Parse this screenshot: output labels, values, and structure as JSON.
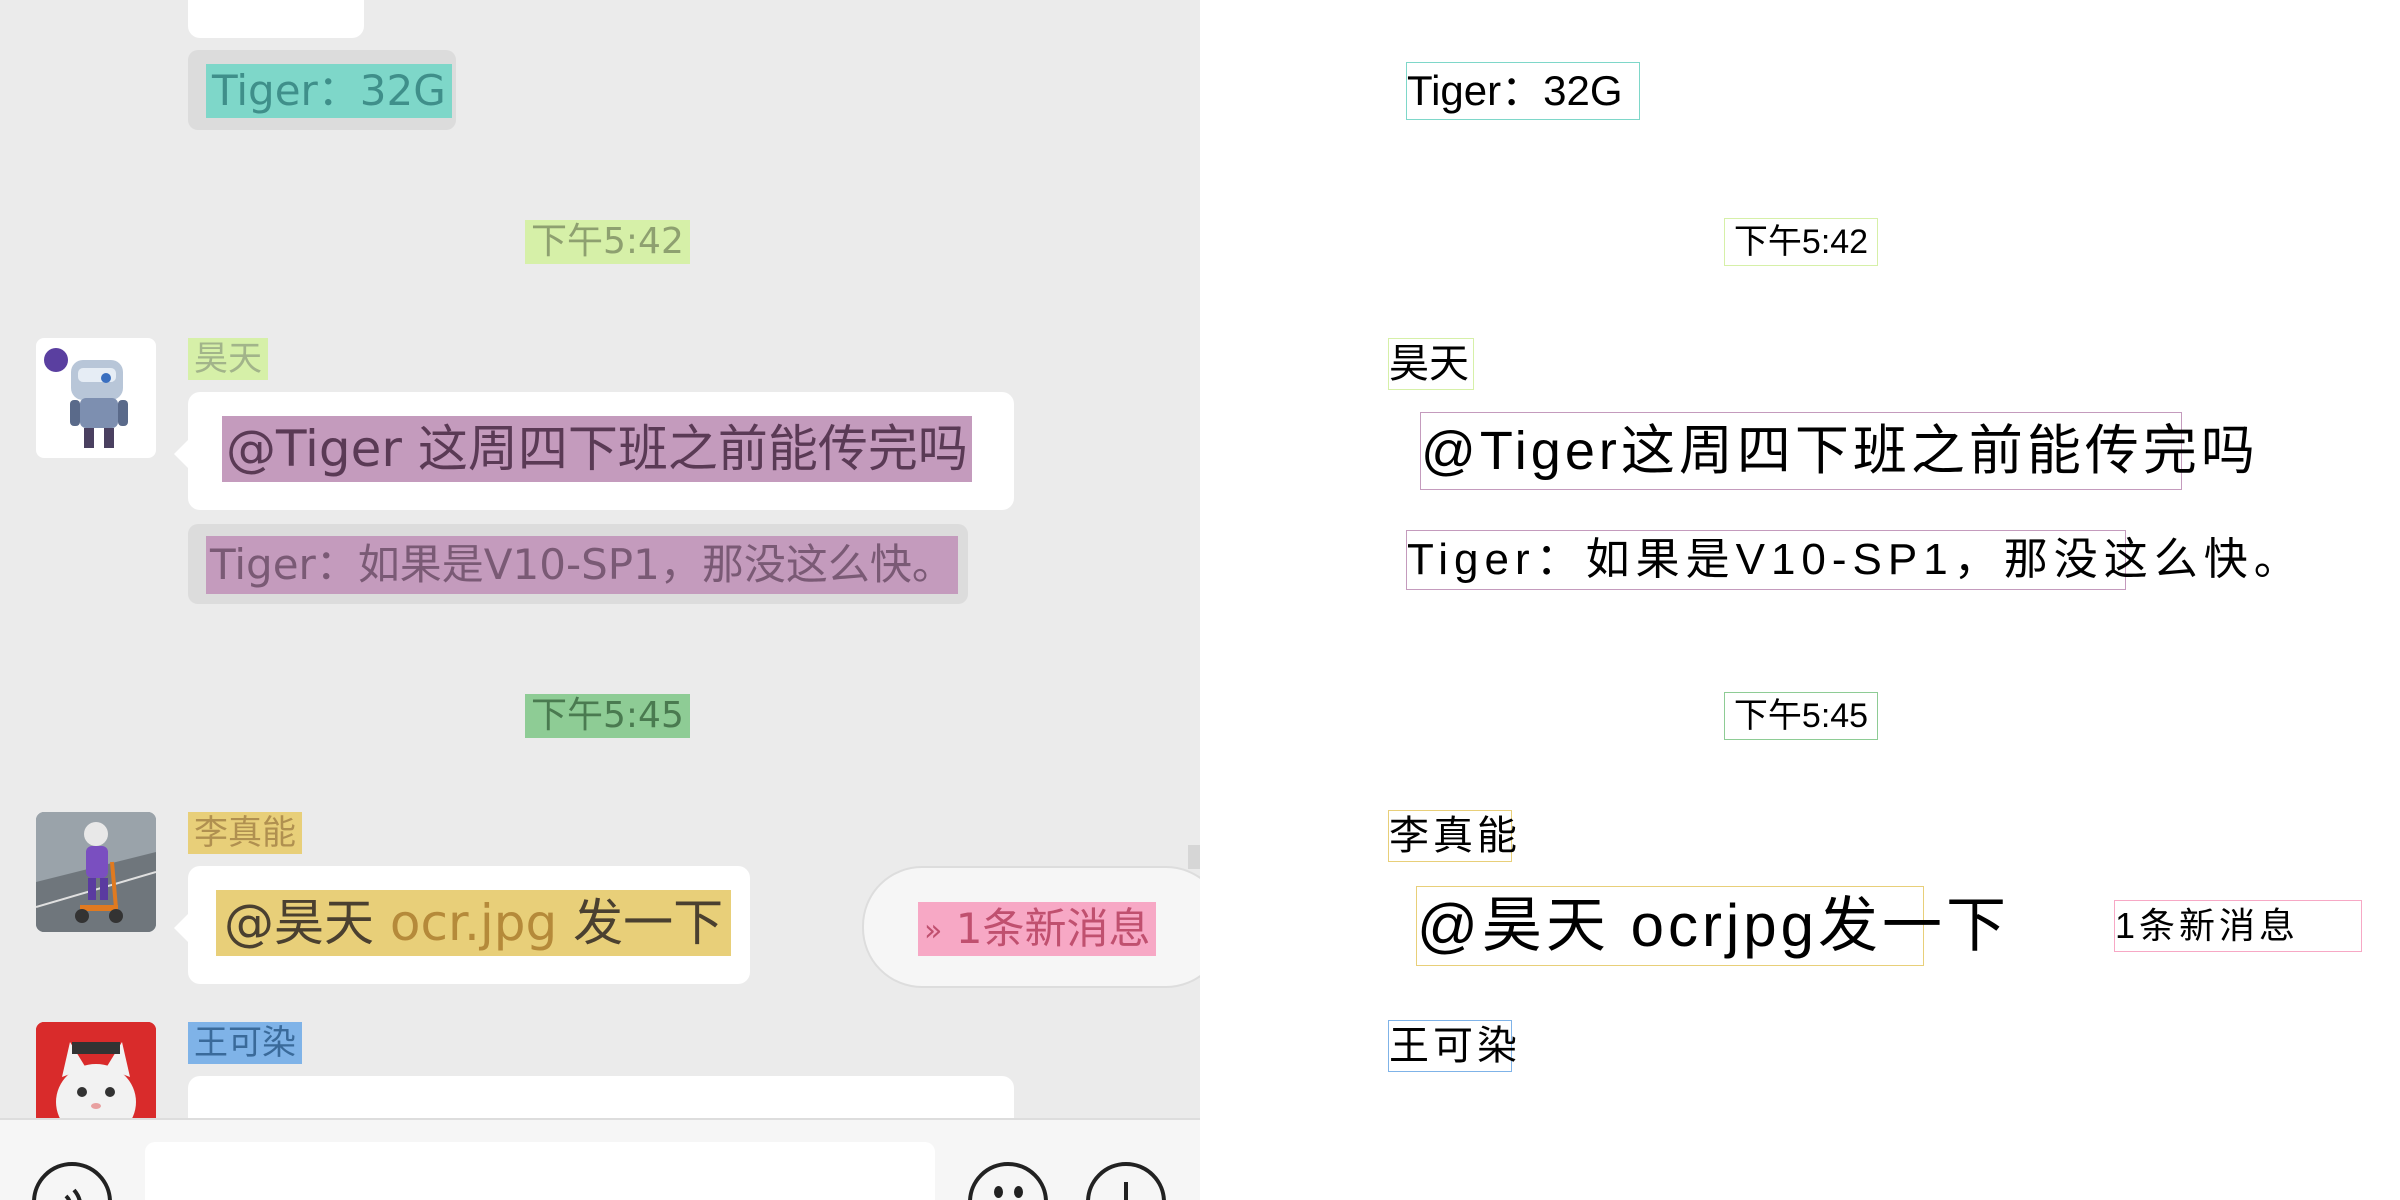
{
  "chat": {
    "quote_top": "Tiger：32G",
    "time_1": "下午5:42",
    "haotian": {
      "name": "昊天",
      "message": "@Tiger 这周四下班之前能传完吗",
      "quote": "Tiger：如果是V10-SP1，那没这么快。"
    },
    "time_2": "下午5:45",
    "lizhenneng": {
      "name": "李真能",
      "mention": "@昊天",
      "file": "ocr.jpg",
      "tail": "发一下"
    },
    "new_messages": "1条新消息",
    "wangkeran": {
      "name": "王可染"
    }
  },
  "ocr": {
    "quote_top": "Tiger：32G",
    "time_1": "下午5:42",
    "name_1": "昊天",
    "message_1": "@Tiger这周四下班之前能传完吗",
    "quote_1": "Tiger：如果是V10-SP1，那没这么快。",
    "time_2": "下午5:45",
    "name_2": "李真能",
    "message_2": "@昊天 ocrjpg发一下",
    "new_messages": "1条新消息",
    "name_3": "王可染"
  },
  "colors": {
    "chat_bg": "#ebebeb",
    "hl_teal": "#7ed7c9",
    "hl_green_light": "#d6f0a8",
    "hl_green": "#8ecc95",
    "hl_purple": "#c49bbd",
    "hl_gold": "#e8cf79",
    "hl_pink": "#f7a8c5",
    "hl_blue": "#7fb3e8"
  },
  "icons": [
    "voice-icon",
    "emoji-icon",
    "plus-icon",
    "double-chevron-down-icon"
  ]
}
